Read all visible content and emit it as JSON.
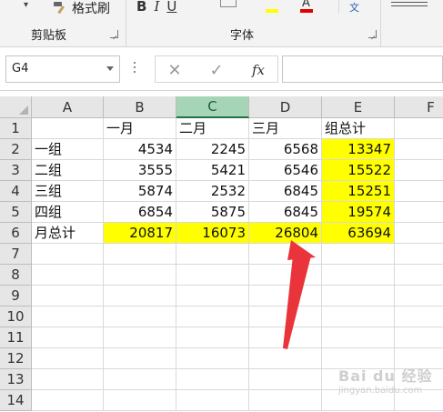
{
  "ribbon": {
    "dropdown_glyph": "▾",
    "format_painter": "格式刷",
    "font_tools": {
      "bold": "B",
      "italic": "I",
      "underline": "U",
      "font_color_letter": "A",
      "phonetic": "文"
    },
    "clipboard_label": "剪贴板",
    "font_label": "字体",
    "colors": {
      "highlight": "#ffff00",
      "font_color": "#e00000"
    }
  },
  "formula_bar": {
    "name_box": "G4",
    "cancel_glyph": "✕",
    "enter_glyph": "✓",
    "fx_glyph": "fx",
    "formula": ""
  },
  "sheet": {
    "columns": [
      "A",
      "B",
      "C",
      "D",
      "E",
      "F"
    ],
    "selected_column": "C",
    "rows": [
      "1",
      "2",
      "3",
      "4",
      "5",
      "6",
      "7",
      "8",
      "9",
      "10",
      "11",
      "12",
      "13",
      "14"
    ],
    "cells": [
      [
        "",
        "一月",
        "二月",
        "三月",
        "组总计",
        ""
      ],
      [
        "一组",
        "4534",
        "2245",
        "6568",
        "13347",
        ""
      ],
      [
        "二组",
        "3555",
        "5421",
        "6546",
        "15522",
        ""
      ],
      [
        "三组",
        "5874",
        "2532",
        "6845",
        "15251",
        ""
      ],
      [
        "四组",
        "6854",
        "5875",
        "6845",
        "19574",
        ""
      ],
      [
        "月总计",
        "20817",
        "16073",
        "26804",
        "63694",
        ""
      ]
    ],
    "highlight_color": "#ffff00"
  },
  "annotation": {
    "arrow_color": "#e8343a"
  },
  "watermark": {
    "logo": "Bai du 经验",
    "url": "jingyan.baidu.com"
  }
}
